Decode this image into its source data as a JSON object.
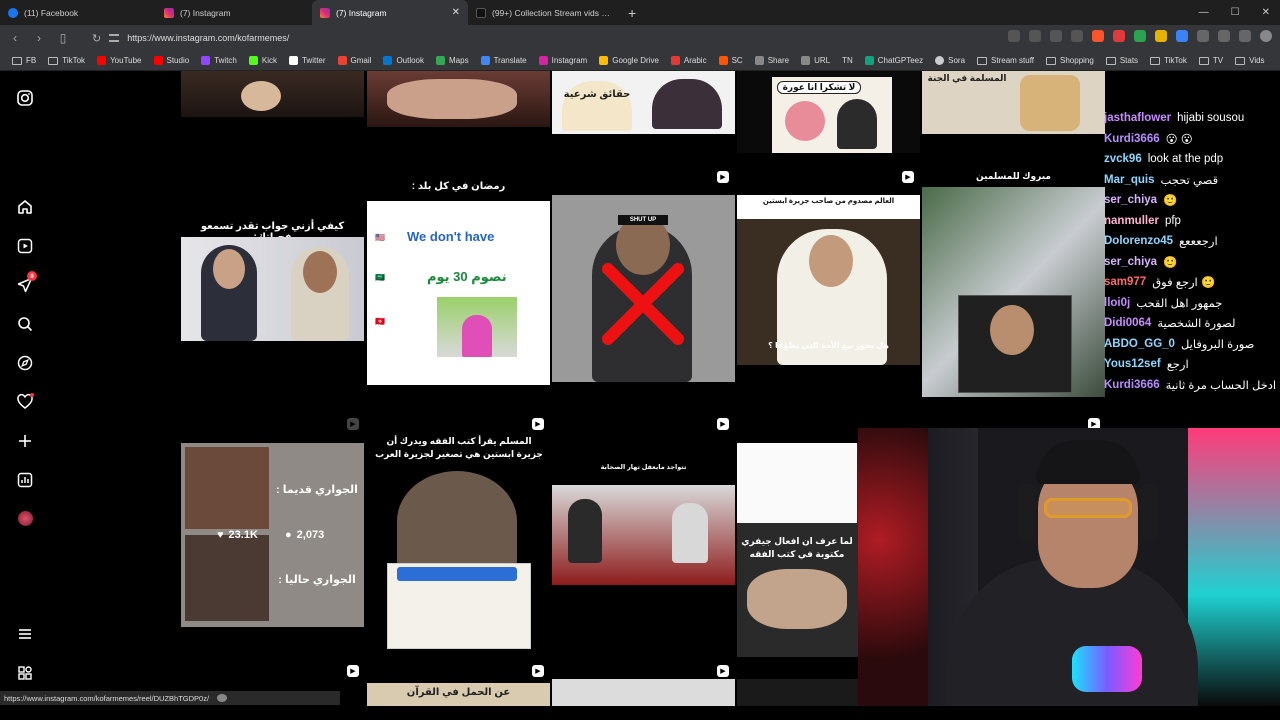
{
  "browser": {
    "tabs": [
      {
        "label": "(11) Facebook",
        "color": "#1877f2",
        "active": false
      },
      {
        "label": "(7) Instagram",
        "color": "#d6249f",
        "active": false
      },
      {
        "label": "(7) Instagram",
        "color": "#d6249f",
        "active": true
      },
      {
        "label": "(99+) Collection Stream vids created ...",
        "color": "#111111",
        "active": false
      }
    ],
    "url": "https://www.instagram.com/kofarmemes/",
    "bookmarks": [
      "FB",
      "TikTok",
      "YouTube",
      "Studio",
      "Twitch",
      "Kick",
      "Twitter",
      "Gmail",
      "Outlook",
      "Maps",
      "Translate",
      "Instagram",
      "Google Drive",
      "Arabic",
      "SC",
      "Share",
      "URL",
      "TN",
      "ChatGPTeez",
      "Sora",
      "Stream stuff",
      "Shopping",
      "Stats",
      "TikTok",
      "TV",
      "Vids"
    ],
    "status_url": "https://www.instagram.com/kofarmemes/reel/DUZBhTGDP0z/"
  },
  "sidebar": {
    "notification_badge": "8"
  },
  "grid": {
    "row1": [
      "حقائق شرعية",
      "لا تشكرا انا عورة",
      "المسلمة في الجنة"
    ],
    "row2": {
      "t1": "كيفي أزني جواب تقدر تسمعو فحياتك:",
      "t2_title": "رمضان في كل بلد :",
      "t2_line1": "We don't have",
      "t2_line2": "نصوم 30 يوم",
      "t3_label": "SHUT UP",
      "t4_title": "العالم مصدوم من صاحب جزيرة ابستين",
      "t4_caption": "هل يجوز بيع الأمة التي يطؤها ؟",
      "t5_title": "مبروك للمسلمين"
    },
    "row3": {
      "t1_top": "الجواري قديما :",
      "t1_bottom": "الجواري حاليا :",
      "likes": "23.1K",
      "comments": "2,073",
      "t2_title": "المسلم يقرأ كتب الفقه ويدرك أن جزيرة ابستين هي تصغير لجزيرة العرب",
      "t3_title": "تتواجد مايعقل تهار الصحابة",
      "t4_title": "لما عرف ان افعال جيفري مكتوبة في كتب الفقه"
    },
    "row4": [
      "عن الحمل في القرآن"
    ]
  },
  "chat": [
    {
      "user": "jasthaflower",
      "msg": "hijabi sousou",
      "color": "#c78bff"
    },
    {
      "user": "Kurdi3666",
      "msg": "😮 😮",
      "color": "#b98cff"
    },
    {
      "user": "zvck96",
      "msg": "look at the pdp",
      "color": "#8ad8ff"
    },
    {
      "user": "Mar_quis",
      "msg": "قصي تحجب",
      "color": "#8ad8ff"
    },
    {
      "user": "ser_chiya",
      "msg": "🙂",
      "color": "#d9b3ff"
    },
    {
      "user": "nanmuller",
      "msg": "pfp",
      "color": "#ffb0d0"
    },
    {
      "user": "Dolorenzo45",
      "msg": "ارجعععع",
      "color": "#8ad8ff"
    },
    {
      "user": "ser_chiya",
      "msg": "🙂",
      "color": "#d9b3ff"
    },
    {
      "user": "sam977",
      "msg": "ارجع فوق 🙂",
      "color": "#ff6b6b"
    },
    {
      "user": "lloi0j",
      "msg": "جمهور اهل القحب",
      "color": "#c78bff"
    },
    {
      "user": "Didi0064",
      "msg": "لصورة الشخصية",
      "color": "#c78bff"
    },
    {
      "user": "ABDO_GG_0",
      "msg": "صورة البروفايل",
      "color": "#8ad8ff"
    },
    {
      "user": "Yous12sef",
      "msg": "ارجع",
      "color": "#8ad8ff"
    },
    {
      "user": "Kurdi3666",
      "msg": "ادخل الحساب مرة ثانية",
      "color": "#b98cff"
    }
  ]
}
